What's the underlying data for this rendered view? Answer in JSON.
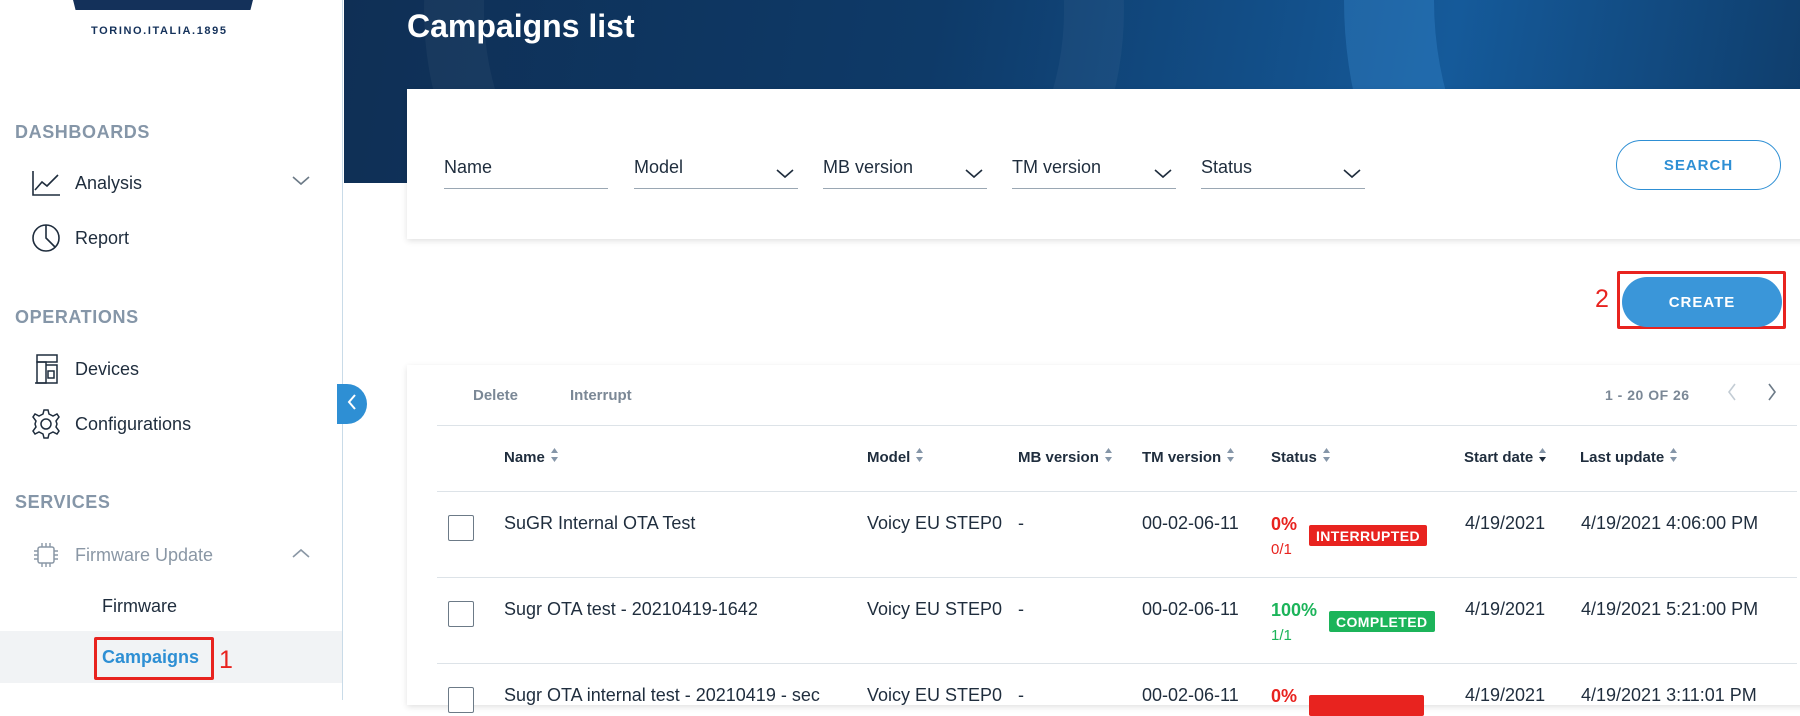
{
  "brand": {
    "tagline": "TORINO.ITALIA.1895"
  },
  "sidebar": {
    "sections": [
      {
        "title": "DASHBOARDS"
      },
      {
        "title": "OPERATIONS"
      },
      {
        "title": "SERVICES"
      }
    ],
    "items": [
      {
        "label": "Analysis",
        "icon": "chart-line-icon",
        "expandable": true
      },
      {
        "label": "Report",
        "icon": "pie-chart-icon"
      },
      {
        "label": "Devices",
        "icon": "coffee-machine-icon"
      },
      {
        "label": "Configurations",
        "icon": "gear-icon"
      },
      {
        "label": "Firmware Update",
        "icon": "chip-icon",
        "expanded": true
      }
    ],
    "subitems": [
      {
        "label": "Firmware"
      },
      {
        "label": "Campaigns",
        "active": true
      }
    ]
  },
  "annotations": {
    "marker_1": "1",
    "marker_2": "2",
    "color": "#e8231f"
  },
  "header": {
    "title": "Campaigns list"
  },
  "filters": {
    "name": "Name",
    "model": "Model",
    "mb_version": "MB version",
    "tm_version": "TM version",
    "status": "Status",
    "search_label": "SEARCH"
  },
  "create_label": "CREATE",
  "table": {
    "actions": {
      "delete": "Delete",
      "interrupt": "Interrupt"
    },
    "pagination": "1 - 20 OF 26",
    "columns": [
      "Name",
      "Model",
      "MB version",
      "TM version",
      "Status",
      "Start date",
      "Last update"
    ],
    "rows": [
      {
        "name": "SuGR Internal OTA Test",
        "model": "Voicy EU STEP0",
        "mb_version": "-",
        "tm_version": "00-02-06-11",
        "percent": "0%",
        "fraction": "0/1",
        "status": "INTERRUPTED",
        "start_date": "4/19/2021",
        "last_update": "4/19/2021 4:06:00 PM"
      },
      {
        "name": "Sugr OTA test - 20210419-1642",
        "model": "Voicy EU STEP0",
        "mb_version": "-",
        "tm_version": "00-02-06-11",
        "percent": "100%",
        "fraction": "1/1",
        "status": "COMPLETED",
        "start_date": "4/19/2021",
        "last_update": "4/19/2021 5:21:00 PM"
      },
      {
        "name": "Sugr OTA internal test - 20210419 - sec",
        "model": "Voicy EU STEP0",
        "mb_version": "-",
        "tm_version": "00-02-06-11",
        "percent": "0%",
        "fraction": "",
        "status": "",
        "start_date": "4/19/2021",
        "last_update": "4/19/2021 3:11:01 PM"
      }
    ]
  },
  "colors": {
    "accent": "#2e8fd4",
    "interrupted": "#e8231f",
    "completed": "#1cb45a",
    "banner": "#0f2f55"
  }
}
